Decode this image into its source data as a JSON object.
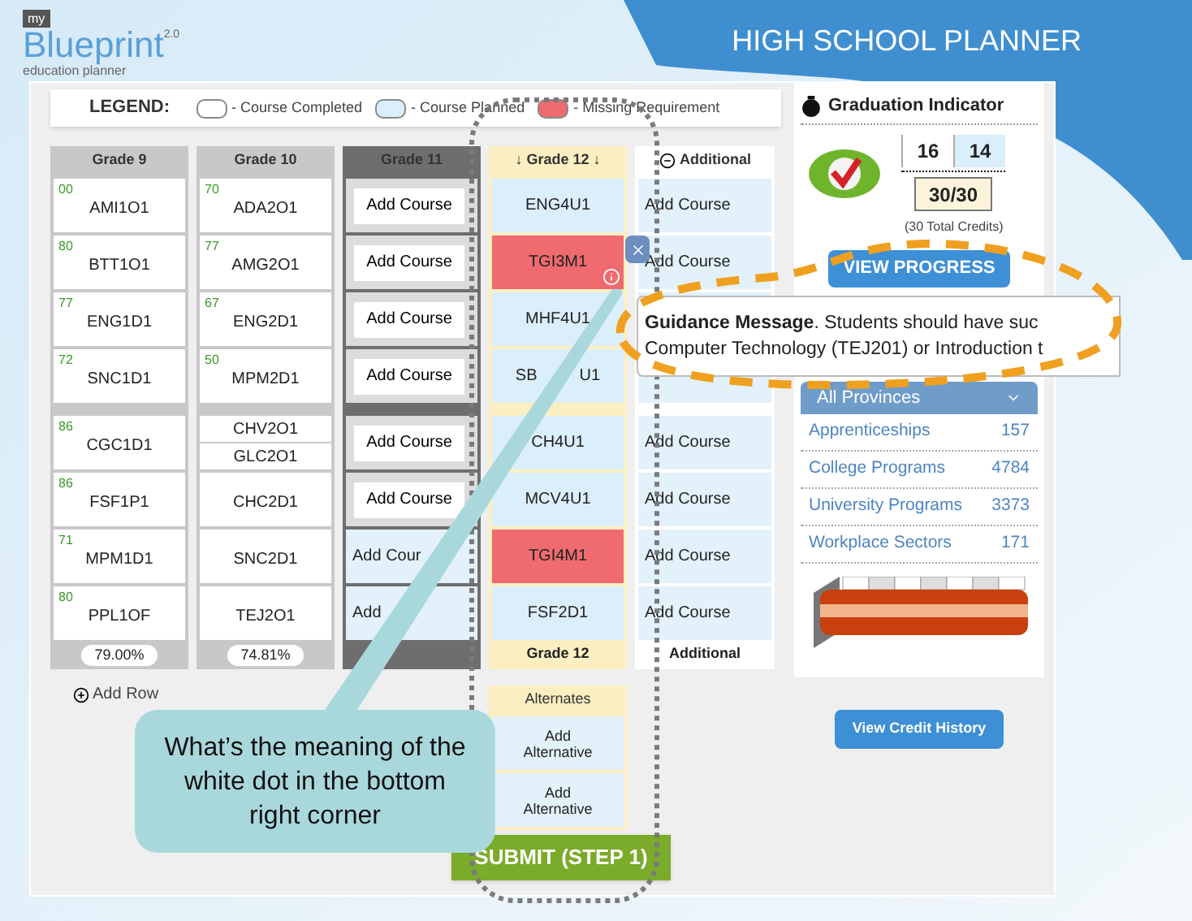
{
  "header": {
    "logo": {
      "badge": "my",
      "name": "Blueprint",
      "version": "2.0",
      "tagline": "education planner"
    },
    "title": "HIGH SCHOOL PLANNER"
  },
  "legend": {
    "label": "LEGEND:",
    "items": [
      {
        "label": "- Course Completed",
        "color": "#ffffff"
      },
      {
        "label": "- Course Planned",
        "color": "#dbeefb"
      },
      {
        "label": "- Missing Requirement",
        "color": "#ef6b6f"
      }
    ]
  },
  "columns": [
    {
      "title": "Grade 9",
      "kind": "completed",
      "footer": "79.00%",
      "groups": [
        [
          {
            "kind": "course",
            "mark": "00",
            "code": "AMI1O1"
          },
          {
            "kind": "course",
            "mark": "80",
            "code": "BTT1O1"
          },
          {
            "kind": "course",
            "mark": "77",
            "code": "ENG1D1"
          },
          {
            "kind": "course",
            "mark": "72",
            "code": "SNC1D1"
          }
        ],
        [
          {
            "kind": "course",
            "mark": "86",
            "code": "CGC1D1"
          },
          {
            "kind": "course",
            "mark": "86",
            "code": "FSF1P1"
          },
          {
            "kind": "course",
            "mark": "71",
            "code": "MPM1D1"
          },
          {
            "kind": "course",
            "mark": "80",
            "code": "PPL1OF"
          }
        ]
      ]
    },
    {
      "title": "Grade 10",
      "kind": "completed",
      "footer": "74.81%",
      "groups": [
        [
          {
            "kind": "course",
            "mark": "70",
            "code": "ADA2O1"
          },
          {
            "kind": "course",
            "mark": "77",
            "code": "AMG2O1"
          },
          {
            "kind": "course",
            "mark": "67",
            "code": "ENG2D1"
          },
          {
            "kind": "course",
            "mark": "50",
            "code": "MPM2D1"
          }
        ],
        [
          {
            "kind": "double",
            "codes": [
              "CHV2O1",
              "GLC2O1"
            ]
          },
          {
            "kind": "course",
            "code": "CHC2D1"
          },
          {
            "kind": "course",
            "code": "SNC2D1"
          },
          {
            "kind": "course",
            "code": "TEJ2O1"
          }
        ]
      ]
    },
    {
      "title": "Grade 11",
      "kind": "current",
      "groups": [
        [
          {
            "kind": "add",
            "code": "Add Course"
          },
          {
            "kind": "add",
            "code": "Add Course"
          },
          {
            "kind": "add",
            "code": "Add Course"
          },
          {
            "kind": "add",
            "code": "Add Course"
          }
        ],
        [
          {
            "kind": "add",
            "code": "Add Course"
          },
          {
            "kind": "add",
            "code": "Add Course"
          },
          {
            "kind": "add-planned",
            "code": "Add Cour"
          },
          {
            "kind": "add-planned",
            "code": "Add"
          }
        ]
      ]
    },
    {
      "title": "↓ Grade 12 ↓",
      "kind": "planned",
      "footer": "Grade 12",
      "groups": [
        [
          {
            "kind": "planned",
            "code": "ENG4U1"
          },
          {
            "kind": "missing",
            "code": "TGI3M1",
            "info": true,
            "removable": true
          },
          {
            "kind": "planned",
            "code": "MHF4U1"
          },
          {
            "kind": "planned",
            "parts": [
              "SB",
              "U1"
            ]
          }
        ],
        [
          {
            "kind": "planned",
            "code": "CH4U1"
          },
          {
            "kind": "planned",
            "code": "MCV4U1"
          },
          {
            "kind": "missing",
            "code": "TGI4M1"
          },
          {
            "kind": "planned",
            "code": "FSF2D1"
          }
        ]
      ]
    },
    {
      "title": "Additional",
      "kind": "additional",
      "footer": "Additional",
      "groups": [
        [
          {
            "kind": "add-planned",
            "code": "Add Course"
          },
          {
            "kind": "add-planned",
            "code": "Add Course"
          },
          {
            "kind": "blank"
          },
          {
            "kind": "blank"
          }
        ],
        [
          {
            "kind": "add-planned",
            "code": "Add Course"
          },
          {
            "kind": "add-planned",
            "code": "Add Course"
          },
          {
            "kind": "add-planned",
            "code": "Add Course"
          },
          {
            "kind": "add-planned",
            "code": "Add Course"
          }
        ]
      ]
    }
  ],
  "add_row": "Add Row",
  "alternates": {
    "title": "Alternates",
    "items": [
      "Add Alternative",
      "Add Alternative"
    ]
  },
  "submit": "SUBMIT (STEP 1)",
  "graduation": {
    "title": "Graduation Indicator",
    "credits": [
      {
        "value": "16",
        "kind": "completed"
      },
      {
        "value": "14",
        "kind": "planned"
      }
    ],
    "total": "30/30",
    "note": "(30 Total Credits)",
    "button": "VIEW PROGRESS"
  },
  "guidance": {
    "line_1": "**Guidance Message**. Students should have suc",
    "line_2": "Computer Technology (TEJ201) or Introduction t"
  },
  "pathways": {
    "dropdown": "All Provinces",
    "items": [
      {
        "name": "Apprenticeships",
        "count": "157"
      },
      {
        "name": "College Programs",
        "count": "4784"
      },
      {
        "name": "University Programs",
        "count": "3373"
      },
      {
        "name": "Workplace Sectors",
        "count": "171"
      }
    ]
  },
  "history_button": "View Credit History",
  "callout": "What’s the meaning of the white dot in the bottom right corner"
}
